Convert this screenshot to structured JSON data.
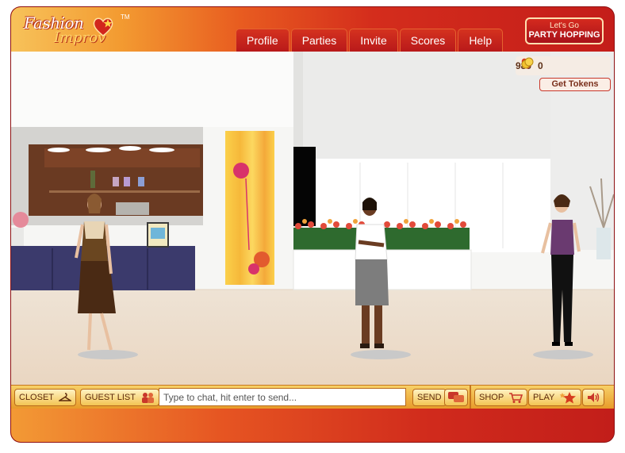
{
  "app": {
    "logo_line1": "Fashion",
    "logo_line2": "Improv",
    "logo_tm": "TM"
  },
  "nav": {
    "tabs": [
      "Profile",
      "Parties",
      "Invite",
      "Scores",
      "Help"
    ]
  },
  "party_button": {
    "line1": "Let's Go",
    "line2": "PARTY HOPPING"
  },
  "stats": {
    "hearts": "980",
    "tokens": "0",
    "get_tokens_label": "Get Tokens"
  },
  "toolbar": {
    "closet_label": "CLOSET",
    "guest_list_label": "GUEST LIST",
    "chat_placeholder": "Type to chat, hit enter to send...",
    "send_label": "SEND",
    "shop_label": "SHOP",
    "play_label": "PLAY"
  },
  "colors": {
    "brand_red": "#c41d1a",
    "brand_orange": "#f39b31",
    "toolbar_gold": "#f3c453"
  },
  "icons": {
    "hearts": "heart-icon",
    "tokens": "coin-icon",
    "closet": "hanger-icon",
    "guest_list": "people-icon",
    "chat": "speech-bubble-icon",
    "shop": "cart-icon",
    "play": "star-icon",
    "sound": "speaker-icon"
  }
}
